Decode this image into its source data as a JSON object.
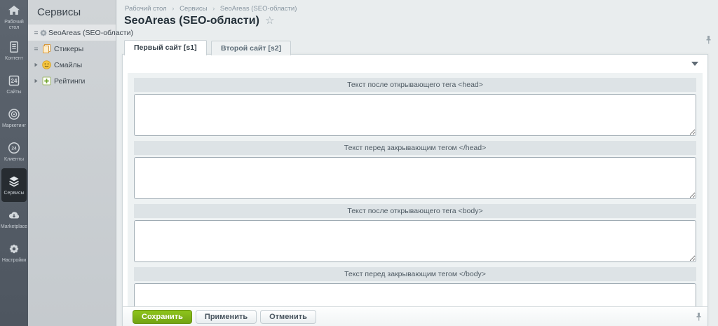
{
  "rail": {
    "items": [
      {
        "label": "Рабочий стол",
        "icon": "home-icon",
        "active": false
      },
      {
        "label": "Контент",
        "icon": "content-icon",
        "active": false
      },
      {
        "label": "Сайты",
        "icon": "sites-icon",
        "icon_text": "24",
        "active": false
      },
      {
        "label": "Маркетинг",
        "icon": "marketing-icon",
        "active": false
      },
      {
        "label": "Клиенты",
        "icon": "clients-icon",
        "icon_text": "24",
        "active": false
      },
      {
        "label": "Сервисы",
        "icon": "services-icon",
        "active": true
      },
      {
        "label": "Marketplace",
        "icon": "marketplace-icon",
        "active": false
      },
      {
        "label": "Настройки",
        "icon": "settings-icon",
        "active": false
      }
    ]
  },
  "sidebar": {
    "title": "Сервисы",
    "items": [
      {
        "label": "SeoAreas (SEO-области)",
        "icon": "gear-icon",
        "active": true
      },
      {
        "label": "Стикеры",
        "icon": "stickers-icon",
        "active": false
      },
      {
        "label": "Смайлы",
        "icon": "smiley-icon",
        "active": false
      },
      {
        "label": "Рейтинги",
        "icon": "ratings-icon",
        "active": false
      }
    ]
  },
  "breadcrumb": {
    "separator": "›",
    "items": [
      "Рабочий стол",
      "Сервисы",
      "SeoAreas (SEO-области)"
    ]
  },
  "page": {
    "title": "SeoAreas (SEO-области)",
    "favorite_icon": "☆"
  },
  "tabs": [
    {
      "label": "Первый сайт [s1]",
      "active": true
    },
    {
      "label": "Второй сайт [s2]",
      "active": false
    }
  ],
  "form": {
    "sections": [
      {
        "label": "Текст после открывающего тега <head>",
        "value": ""
      },
      {
        "label": "Текст перед закрывающим тегом </head>",
        "value": ""
      },
      {
        "label": "Текст после открывающего тега <body>",
        "value": ""
      },
      {
        "label": "Текст перед закрывающим тегом </body>",
        "value": ""
      }
    ]
  },
  "footer": {
    "buttons": [
      {
        "label": "Сохранить",
        "type": "primary"
      },
      {
        "label": "Применить",
        "type": "default"
      },
      {
        "label": "Отменить",
        "type": "default"
      }
    ]
  },
  "colors": {
    "primary_button": "#7fb41a",
    "rail_bg": "#565e68",
    "rail_active_bg": "#272c31",
    "sidebar_bg": "#cbd0d3",
    "page_bg": "#e9edee",
    "label_bar_bg": "#dde3e6"
  }
}
